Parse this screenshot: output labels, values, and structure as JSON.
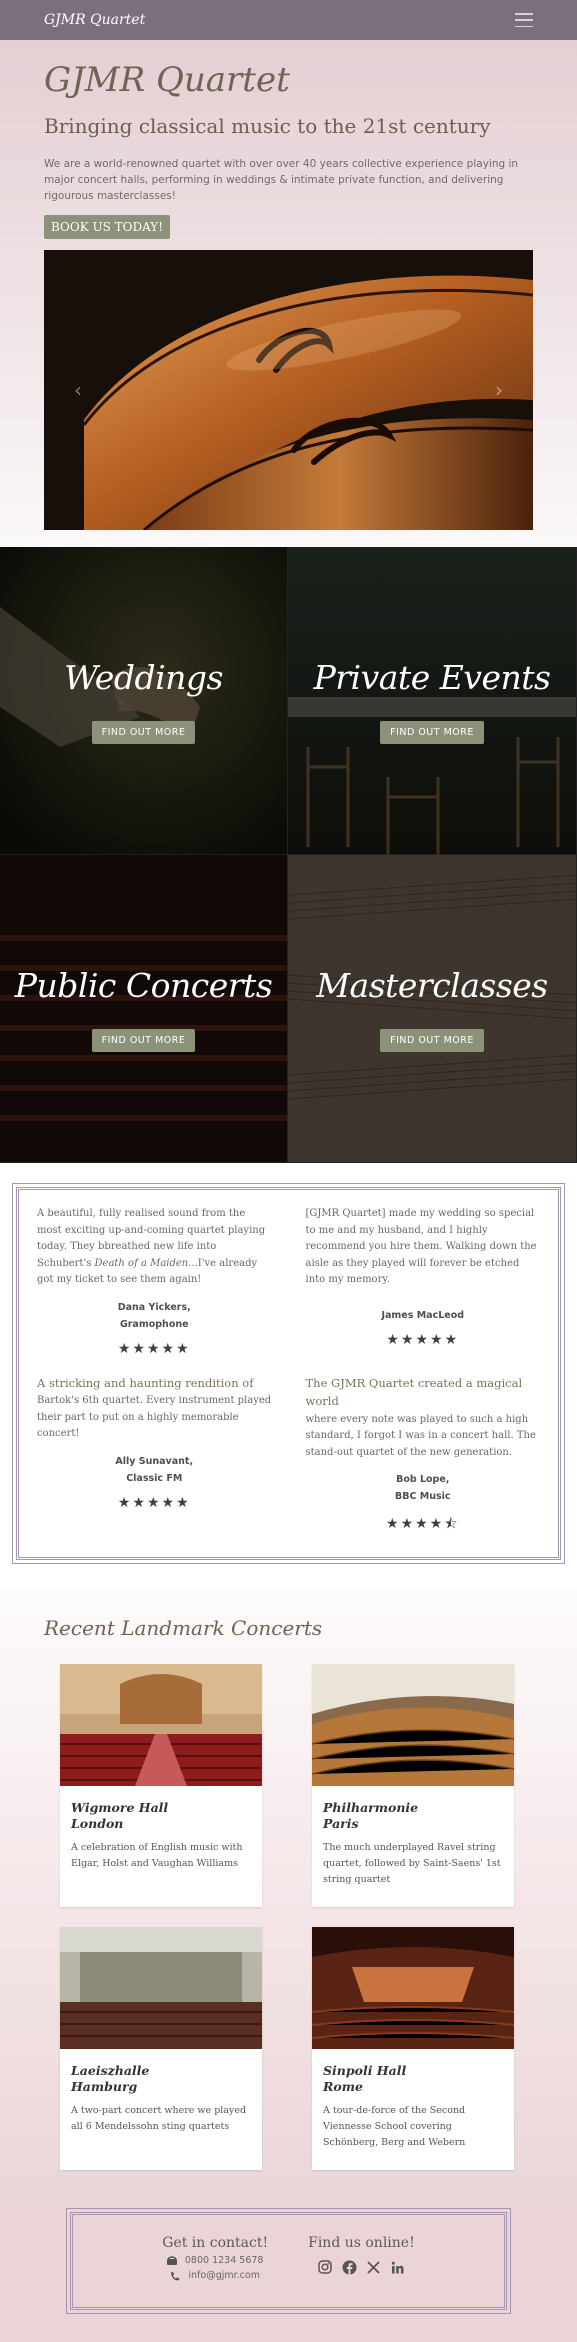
{
  "nav": {
    "brand": "GJMR Quartet"
  },
  "hero": {
    "title": "GJMR Quartet",
    "subtitle": "Bringing classical music to the 21st century",
    "description": "We are a world-renowned quartet with over over 40 years collective experience playing in major concert halls, performing in weddings & intimate private function, and delivering rigourous masterclasses!",
    "cta": "BOOK US TODAY!",
    "carousel": {
      "prev": "‹",
      "next": "›"
    }
  },
  "services": [
    {
      "title": "Weddings",
      "button": "FIND OUT MORE"
    },
    {
      "title": "Private Events",
      "button": "FIND OUT MORE"
    },
    {
      "title": "Public Concerts",
      "button": "FIND OUT MORE"
    },
    {
      "title": "Masterclasses",
      "button": "FIND OUT MORE"
    }
  ],
  "testimonials": [
    {
      "quote_a": "A beautiful, fully realised sound from the most exciting up-and-coming quartet playing today. They bbreathed new life into Schubert's ",
      "quote_em": "Death of a Maiden",
      "quote_b": "...I've already got my ticket to see them again!",
      "author_line1": "Dana Yickers,",
      "author_line2": "Gramophone",
      "stars": "★★★★★"
    },
    {
      "quote": "[GJMR Quartet] made my wedding so special to me and my husband, and I highly recommend you hire them. Walking down the aisle as they played will forever be etched into my memory.",
      "author_line1": "James MacLeod",
      "stars": "★★★★★"
    },
    {
      "quote_lead": "A stricking and haunting rendition of",
      "quote": "Bartok's 6th quartet. Every instrument played their part to put on a highly memorable concert!",
      "author_line1": "Ally Sunavant,",
      "author_line2": "Classic FM",
      "stars": "★★★★★"
    },
    {
      "quote_lead": "The GJMR Quartet created a magical world",
      "quote": "where every note was played to such a high standard, I forgot I was in a concert hall. The stand-out quartet of the new generation.",
      "author_line1": "Bob Lope,",
      "author_line2": "BBC Music",
      "stars": "★★★★⯪"
    }
  ],
  "recent": {
    "title": "Recent Landmark Concerts",
    "cards": [
      {
        "venue": "Wigmore Hall",
        "city": "London",
        "text": "A celebration of English music with Elgar, Holst and Vaughan Williams"
      },
      {
        "venue": "Philharmonie",
        "city": "Paris",
        "text": "The much underplayed Ravel string quartet, followed by Saint-Saens' 1st string quartet"
      },
      {
        "venue": "Laeiszhalle",
        "city": "Hamburg",
        "text": "A two-part concert where we played all 6 Mendelssohn sting quartets"
      },
      {
        "venue": "Sinpoli Hall",
        "city": "Rome",
        "text": "A tour-de-force of the Second Viennesse School covering Schönberg, Berg and Webern"
      }
    ]
  },
  "contact": {
    "heading": "Get in contact!",
    "phone": "0800 1234 5678",
    "email": "info@gjmr.com",
    "online_heading": "Find us online!",
    "socials": [
      "instagram-icon",
      "facebook-icon",
      "x-icon",
      "linkedin-icon"
    ]
  },
  "colors": {
    "nav": "#7b6f7e",
    "accent_button": "#8c927a",
    "frame": "#a495b0"
  }
}
